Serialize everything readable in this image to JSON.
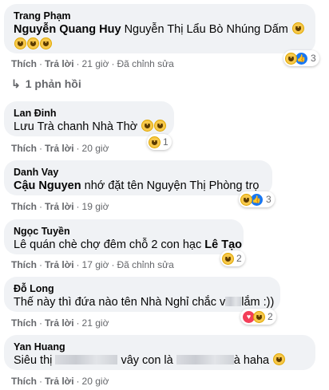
{
  "comments": [
    {
      "author": "Trang Phạm",
      "tag": "Nguyễn Quang Huy",
      "text": "Nguyễn Thị Lẩu Bò Nhúng Dấm",
      "like": "Thích",
      "reply": "Trả lời",
      "time": "21 giờ",
      "edited": "Đã chỉnh sửa",
      "reaction_count": "3",
      "reactions": [
        "laugh-emoji",
        "like-icon"
      ]
    },
    {
      "author": "Lan Đinh",
      "text": "Lưu Trà chanh Nhà Thờ",
      "like": "Thích",
      "reply": "Trả lời",
      "time": "20 giờ",
      "reaction_count": "1",
      "reactions": [
        "laugh-emoji"
      ]
    },
    {
      "author": "Danh Vay",
      "tag": "Cậu Nguyen",
      "text": "nhớ đặt tên Nguyện Thị Phòng trọ",
      "like": "Thích",
      "reply": "Trả lời",
      "time": "19 giờ",
      "reaction_count": "3",
      "reactions": [
        "laugh-emoji",
        "like-icon"
      ]
    },
    {
      "author": "Ngọc Tuyền",
      "text": "Lê quán chè chợ đêm chỗ 2 con hạc",
      "tag": "Lê Tạo",
      "like": "Thích",
      "reply": "Trả lời",
      "time": "17 giờ",
      "edited": "Đã chỉnh sửa",
      "reaction_count": "2",
      "reactions": [
        "laugh-emoji"
      ]
    },
    {
      "author": "Đỗ Long",
      "text_before": "Thế này thì đứa nào tên Nhà Nghỉ chắc v",
      "text_after": "lắm :))",
      "like": "Thích",
      "reply": "Trả lời",
      "time": "21 giờ",
      "reaction_count": "2",
      "reactions": [
        "love-icon",
        "laugh-emoji"
      ]
    },
    {
      "author": "Yan Huang",
      "text_before": "Siêu thị",
      "text_middle": "vây con là",
      "text_after": "à haha",
      "like": "Thích",
      "reply": "Trả lời",
      "time": "20 giờ"
    }
  ],
  "replies_link": "1 phản hồi",
  "colors": {
    "bubble": "#f0f2f5",
    "meta": "#65676b",
    "like": "#1877f2",
    "love": "#f33e58"
  }
}
